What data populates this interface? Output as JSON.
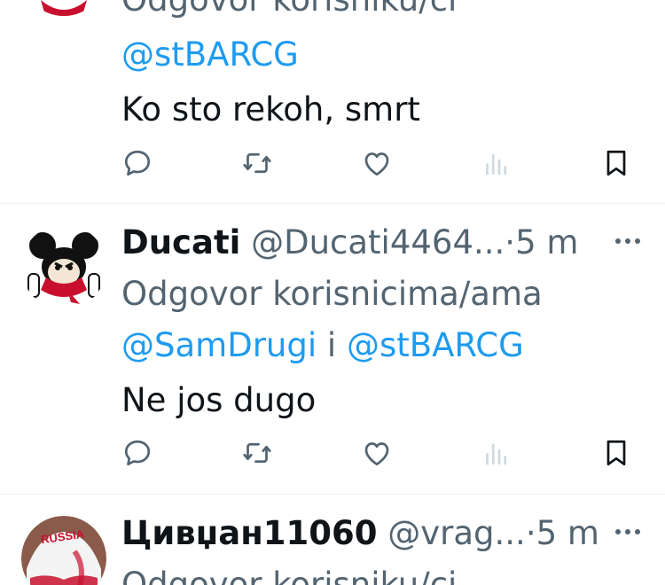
{
  "tweets": [
    {
      "reply_label": "Odgovor korisniku/ci",
      "mentions": [
        "@stBARCG"
      ],
      "text": "Ko sto rekoh, smrt"
    },
    {
      "name": "Ducati",
      "handle": "@Ducati4464...",
      "dot": "·",
      "time": "5 m",
      "reply_label": "Odgovor korisnicima/ama",
      "mentions": [
        "@SamDrugi",
        "@stBARCG"
      ],
      "mention_join": "i",
      "text": "Ne jos dugo"
    },
    {
      "name": "Цивџан11060",
      "handle": "@vrag...",
      "dot": "·",
      "time": "5 m",
      "reply_label": "Odgovor korisniku/ci",
      "avatar_text": "RUSSIA"
    }
  ],
  "icons": {
    "reply": "reply-icon",
    "retweet": "retweet-icon",
    "like": "like-icon",
    "views": "views-icon",
    "bookmark": "bookmark-icon",
    "more": "more-icon"
  },
  "colors": {
    "text": "#0f1419",
    "secondary": "#536471",
    "link": "#1d9bf0",
    "divider": "#eff3f4"
  }
}
